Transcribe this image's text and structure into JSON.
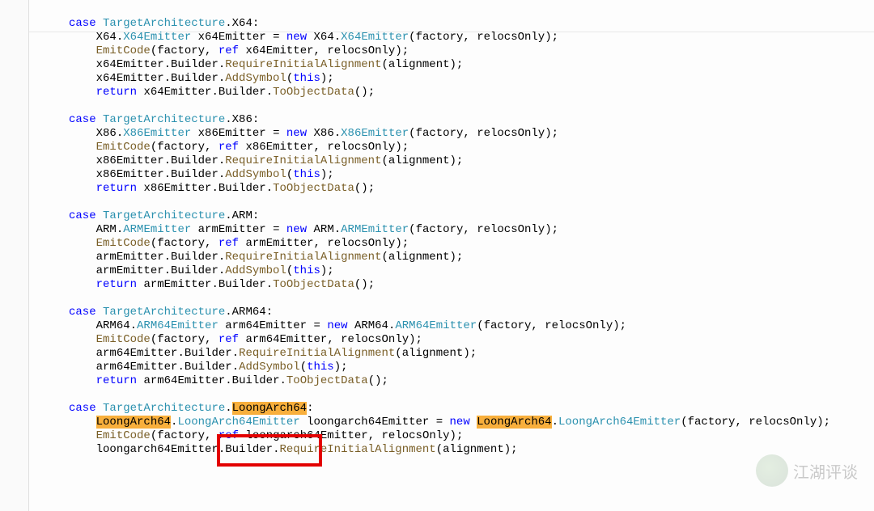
{
  "code": {
    "case_prefix": "case",
    "new_kw": "new",
    "return_kw": "return",
    "ref_kw": "ref",
    "this_kw": "this",
    "target_arch": "TargetArchitecture",
    "x64": {
      "enum": "X64",
      "ns": "X64",
      "emitter_type": "X64Emitter",
      "var": "x64Emitter"
    },
    "x86": {
      "enum": "X86",
      "ns": "X86",
      "emitter_type": "X86Emitter",
      "var": "x86Emitter"
    },
    "arm": {
      "enum": "ARM",
      "ns": "ARM",
      "emitter_type": "ARMEmitter",
      "var": "armEmitter"
    },
    "arm64": {
      "enum": "ARM64",
      "ns": "ARM64",
      "emitter_type": "ARM64Emitter",
      "var": "arm64Emitter"
    },
    "loong": {
      "enum": "LoongArch64",
      "ns": "LoongArch64",
      "emitter_type": "LoongArch64Emitter",
      "emitter_type_partial": "Loongarch64Emitter",
      "var_partial1": "LoongArch64Emitter",
      "var_partial2": "loongarch64Emitter",
      "var": "loongarch64Emitter"
    },
    "methods": {
      "emit_code": "EmitCode",
      "req_align": "RequireInitialAlignment",
      "add_symbol": "AddSymbol",
      "to_obj": "ToObjectData"
    },
    "props": {
      "builder": "Builder"
    },
    "args": {
      "factory": "factory",
      "relocs": "relocsOnly",
      "alignment": "alignment"
    }
  },
  "watermark": "江湖评谈"
}
